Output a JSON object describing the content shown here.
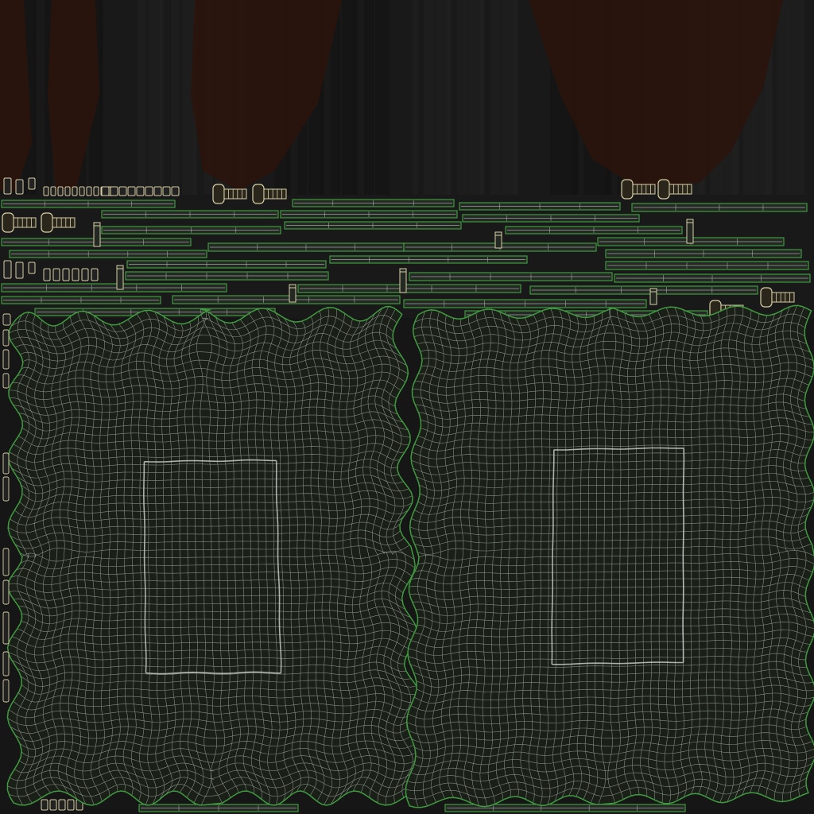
{
  "colors": {
    "background": "#161616",
    "background_band": "#1d1d1d",
    "curtain_fill": "#2b140c",
    "panel_fill": "#1a2018",
    "grid_line": "#a8b0a8",
    "island_outline": "#3f9a3f",
    "strip_fill": "#242924",
    "strip_line": "#b9beb9",
    "bolt_outline": "#d8cfa6"
  },
  "content": {
    "image_kind": "uv-texture-layout",
    "text_elements": []
  }
}
